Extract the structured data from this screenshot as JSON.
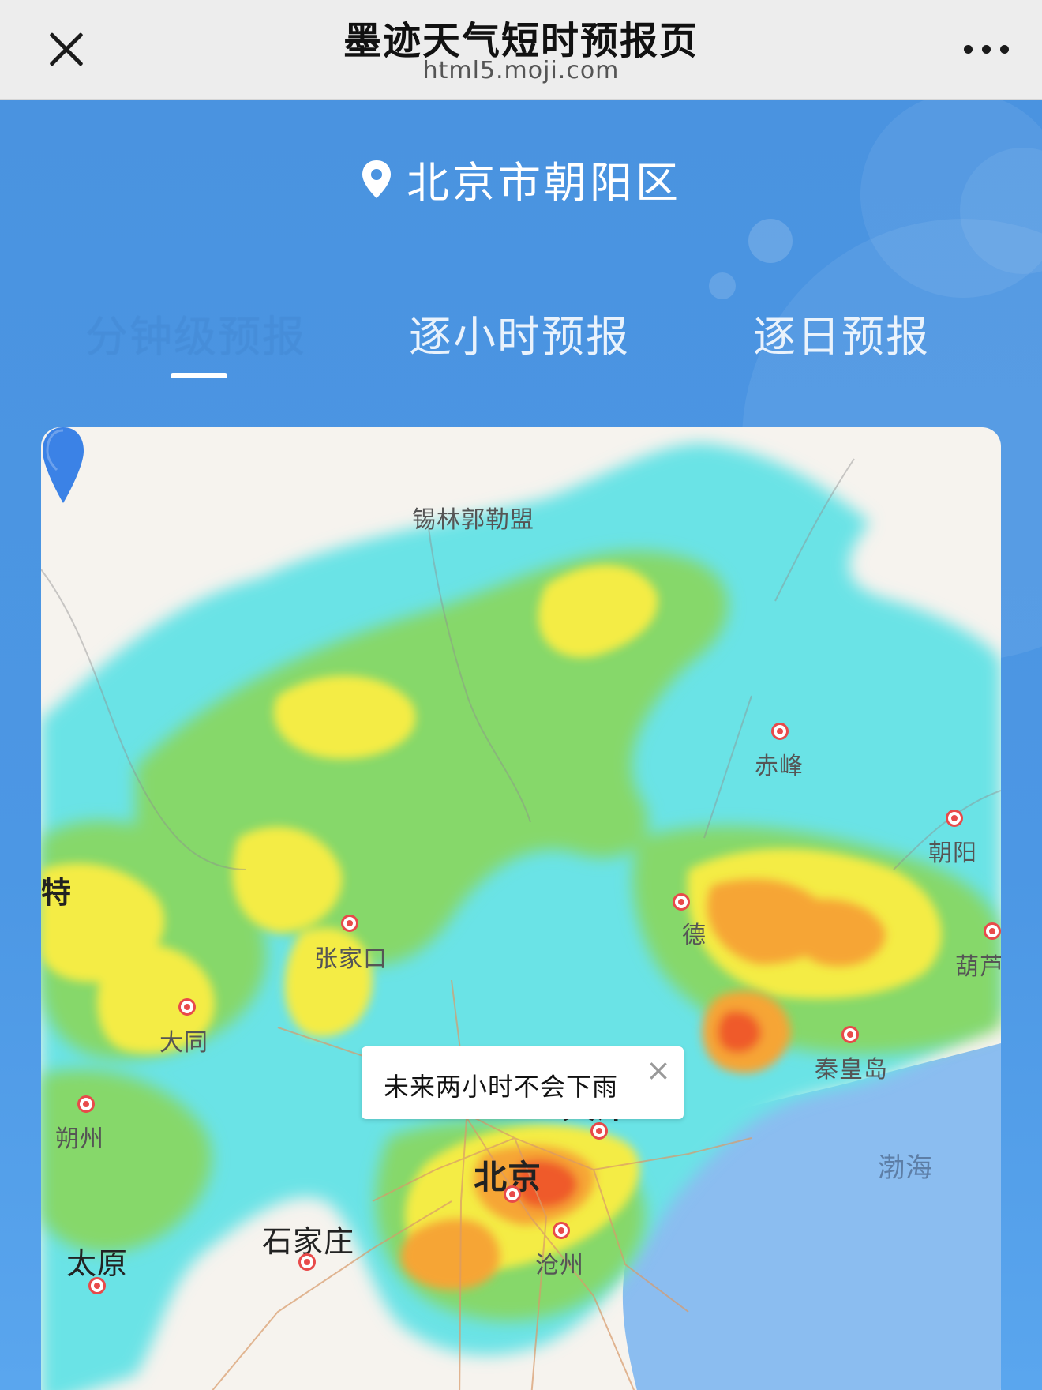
{
  "topbar": {
    "title": "墨迹天气短时预报页",
    "url": "html5.moji.com",
    "close_icon": "close-icon",
    "more_icon": "more-dots-icon"
  },
  "location": {
    "icon": "location-pin-icon",
    "name": "北京市朝阳区"
  },
  "tabs": [
    {
      "label": "分钟级预报",
      "active": true
    },
    {
      "label": "逐小时预报",
      "active": false
    },
    {
      "label": "逐日预报",
      "active": false
    }
  ],
  "map": {
    "cities": [
      {
        "name": "锡林郭勒盟"
      },
      {
        "name": "赤峰"
      },
      {
        "name": "朝阳"
      },
      {
        "name": "特"
      },
      {
        "name": "张家口"
      },
      {
        "name": "德"
      },
      {
        "name": "葫芦"
      },
      {
        "name": "北京"
      },
      {
        "name": "大同"
      },
      {
        "name": "秦皇岛"
      },
      {
        "name": "朔州"
      },
      {
        "name": "天津"
      },
      {
        "name": "渤海"
      },
      {
        "name": "石家庄"
      },
      {
        "name": "太原"
      },
      {
        "name": "沧州"
      }
    ],
    "popup": {
      "text": "未来两小时不会下雨",
      "close": "×"
    },
    "colors": {
      "light": "#6be3e6",
      "green": "#86d86a",
      "yellow": "#f4ec44",
      "orange": "#f6a534",
      "red": "#ef5a2a",
      "sea": "#8bbdf0"
    }
  }
}
